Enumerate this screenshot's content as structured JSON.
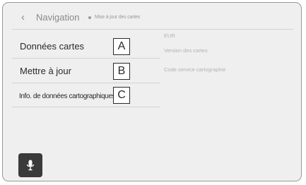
{
  "header": {
    "back_symbol": "‹",
    "title": "Navigation",
    "subtitle": "Mise à jour des cartes"
  },
  "menu": {
    "items": [
      {
        "label": "Données cartes",
        "callout": "A"
      },
      {
        "label": "Mettre à jour",
        "callout": "B"
      },
      {
        "label": "Info. de données cartographiques",
        "callout": "C"
      }
    ]
  },
  "info": {
    "region": "EUR",
    "map_version_label": "Version des cartes",
    "service_code_label": "Code service cartographie"
  },
  "icons": {
    "back": "chevron-left-icon",
    "voice": "microphone-icon"
  },
  "colors": {
    "background": "#efefef",
    "text": "#2a2a2a",
    "muted_text": "#8a8a8a",
    "voice_button": "#3a3a3a"
  }
}
